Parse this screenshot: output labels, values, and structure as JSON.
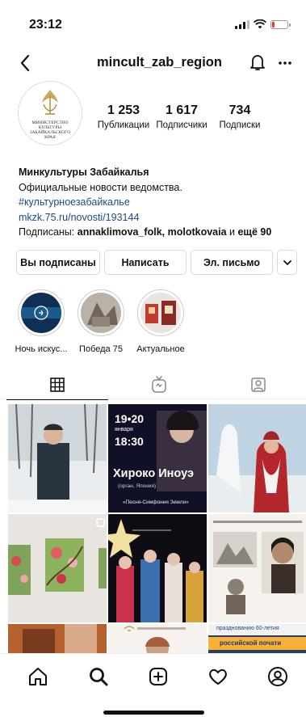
{
  "status_bar": {
    "time": "23:12"
  },
  "header": {
    "username": "mincult_zab_region"
  },
  "profile": {
    "avatar_caption": "Министерство культуры Забайкальского края",
    "stats": [
      {
        "value": "1 253",
        "label": "Публикации"
      },
      {
        "value": "1 617",
        "label": "Подписчики"
      },
      {
        "value": "734",
        "label": "Подписки"
      }
    ],
    "bio": {
      "name": "Минкультуры Забайкалья",
      "description": "Официальные новости ведомства.",
      "hashtag": "#культурноезабайкалье",
      "website": "mkzk.75.ru/novosti/193144",
      "followed_by_prefix": "Подписаны: ",
      "followed_by_names": "annaklimova_folk, molotkovaia",
      "followed_by_mid": " и ",
      "followed_by_more": "ещё 90"
    }
  },
  "actions": {
    "following": "Вы подписаны",
    "message": "Написать",
    "email": "Эл. письмо"
  },
  "highlights": [
    {
      "label": "Ночь искус..."
    },
    {
      "label": "Победа 75"
    },
    {
      "label": "Актуальное"
    }
  ],
  "posts": {
    "tile_2": {
      "date_top": "19•20",
      "month": "января",
      "time": "18:30",
      "title": "Хироко Иноуэ",
      "sub": "(орган, Япония)",
      "footer": "«Песня-Симфония Земли»"
    },
    "tile_8_banner": "празднованию 60-летия",
    "tile_9_banner": "российской почати"
  },
  "colors": {
    "link": "#1b4a86",
    "border": "#dbdbdb",
    "text": "#111111"
  }
}
